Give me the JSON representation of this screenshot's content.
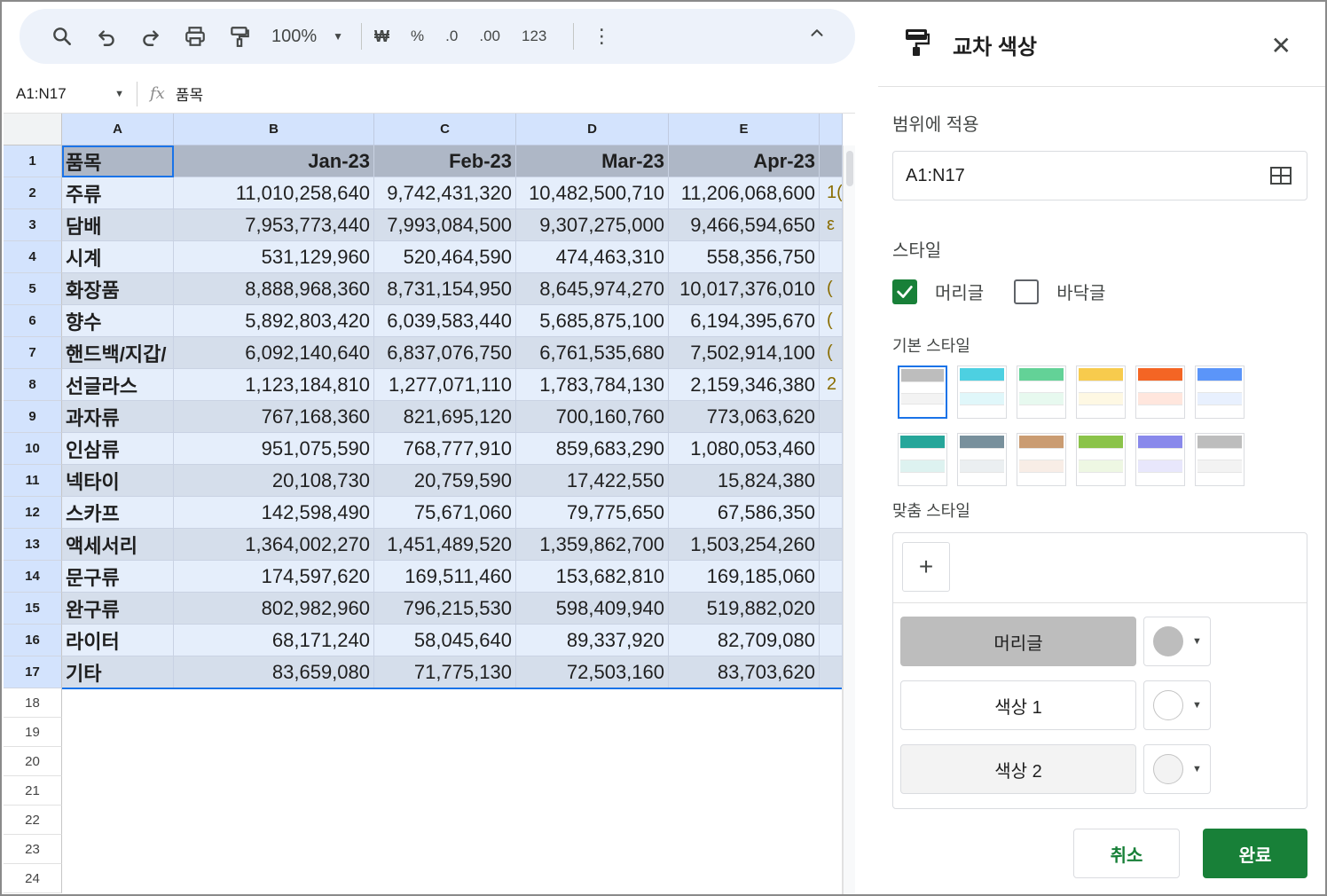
{
  "toolbar": {
    "zoom": "100%",
    "currency": "₩",
    "percent": "%",
    "dec_decrease": ".0",
    "dec_increase": ".00",
    "number_format": "123"
  },
  "formula_bar": {
    "name_box": "A1:N17",
    "fx": "fx",
    "value": "품목"
  },
  "sheet": {
    "columns": [
      "A",
      "B",
      "C",
      "D",
      "E"
    ],
    "row_numbers": [
      "1",
      "2",
      "3",
      "4",
      "5",
      "6",
      "7",
      "8",
      "9",
      "10",
      "11",
      "12",
      "13",
      "14",
      "15",
      "16",
      "17",
      "18",
      "19",
      "20",
      "21",
      "22",
      "23",
      "24"
    ],
    "header": [
      "품목",
      "Jan-23",
      "Feb-23",
      "Mar-23",
      "Apr-23"
    ],
    "rows": [
      {
        "item": "주류",
        "values": [
          "11,010,258,640",
          "9,742,431,320",
          "10,482,500,710",
          "11,206,068,600"
        ],
        "next": "1("
      },
      {
        "item": "담배",
        "values": [
          "7,953,773,440",
          "7,993,084,500",
          "9,307,275,000",
          "9,466,594,650"
        ],
        "next": "ε"
      },
      {
        "item": "시계",
        "values": [
          "531,129,960",
          "520,464,590",
          "474,463,310",
          "558,356,750"
        ],
        "next": ""
      },
      {
        "item": "화장품",
        "values": [
          "8,888,968,360",
          "8,731,154,950",
          "8,645,974,270",
          "10,017,376,010"
        ],
        "next": "("
      },
      {
        "item": "향수",
        "values": [
          "5,892,803,420",
          "6,039,583,440",
          "5,685,875,100",
          "6,194,395,670"
        ],
        "next": "("
      },
      {
        "item": "핸드백/지갑/",
        "values": [
          "6,092,140,640",
          "6,837,076,750",
          "6,761,535,680",
          "7,502,914,100"
        ],
        "next": "("
      },
      {
        "item": "선글라스",
        "values": [
          "1,123,184,810",
          "1,277,071,110",
          "1,783,784,130",
          "2,159,346,380"
        ],
        "next": "2"
      },
      {
        "item": "과자류",
        "values": [
          "767,168,360",
          "821,695,120",
          "700,160,760",
          "773,063,620"
        ],
        "next": ""
      },
      {
        "item": "인삼류",
        "values": [
          "951,075,590",
          "768,777,910",
          "859,683,290",
          "1,080,053,460"
        ],
        "next": ""
      },
      {
        "item": "넥타이",
        "values": [
          "20,108,730",
          "20,759,590",
          "17,422,550",
          "15,824,380"
        ],
        "next": ""
      },
      {
        "item": "스카프",
        "values": [
          "142,598,490",
          "75,671,060",
          "79,775,650",
          "67,586,350"
        ],
        "next": ""
      },
      {
        "item": "액세서리",
        "values": [
          "1,364,002,270",
          "1,451,489,520",
          "1,359,862,700",
          "1,503,254,260"
        ],
        "next": ""
      },
      {
        "item": "문구류",
        "values": [
          "174,597,620",
          "169,511,460",
          "153,682,810",
          "169,185,060"
        ],
        "next": ""
      },
      {
        "item": "완구류",
        "values": [
          "802,982,960",
          "796,215,530",
          "598,409,940",
          "519,882,020"
        ],
        "next": ""
      },
      {
        "item": "라이터",
        "values": [
          "68,171,240",
          "58,045,640",
          "89,337,920",
          "82,709,080"
        ],
        "next": ""
      },
      {
        "item": "기타",
        "values": [
          "83,659,080",
          "71,775,130",
          "72,503,160",
          "83,703,620"
        ],
        "next": ""
      }
    ]
  },
  "panel": {
    "title": "교차 색상",
    "apply_range_label": "범위에 적용",
    "range": "A1:N17",
    "style_label": "스타일",
    "header_checkbox": {
      "label": "머리글",
      "checked": true
    },
    "footer_checkbox": {
      "label": "바닥글",
      "checked": false
    },
    "default_styles_label": "기본 스타일",
    "default_styles": [
      {
        "header": "#bdbdbd",
        "c1": "#ffffff",
        "c2": "#f3f3f3"
      },
      {
        "header": "#4dd0e1",
        "c1": "#ffffff",
        "c2": "#e0f7fa"
      },
      {
        "header": "#63d297",
        "c1": "#ffffff",
        "c2": "#e7f9ef"
      },
      {
        "header": "#f7cb4d",
        "c1": "#ffffff",
        "c2": "#fef8e3"
      },
      {
        "header": "#f46524",
        "c1": "#ffffff",
        "c2": "#ffe6dd"
      },
      {
        "header": "#5b95f9",
        "c1": "#ffffff",
        "c2": "#e8f0fe"
      },
      {
        "header": "#26a69a",
        "c1": "#ffffff",
        "c2": "#ddf2f0"
      },
      {
        "header": "#78909c",
        "c1": "#ffffff",
        "c2": "#ebeff1"
      },
      {
        "header": "#ca9c72",
        "c1": "#ffffff",
        "c2": "#f8ede6"
      },
      {
        "header": "#8bc34a",
        "c1": "#ffffff",
        "c2": "#eef7e3"
      },
      {
        "header": "#8989eb",
        "c1": "#ffffff",
        "c2": "#e8e7fc"
      },
      {
        "header": "#bdbdbd",
        "c1": "#ffffff",
        "c2": "#f3f3f3"
      }
    ],
    "custom_styles_label": "맞춤 스타일",
    "add_label": "+",
    "roles": [
      {
        "label": "머리글",
        "color": "#bdbdbd"
      },
      {
        "label": "색상 1",
        "color": "#ffffff"
      },
      {
        "label": "색상 2",
        "color": "#f3f3f3"
      }
    ],
    "cancel_label": "취소",
    "done_label": "완료"
  },
  "colors": {
    "header_fill": "#aeb7c6",
    "band1": "#e5eefb",
    "band2": "#d5deeb",
    "selection": "#1a73e8",
    "primary": "#188038"
  }
}
